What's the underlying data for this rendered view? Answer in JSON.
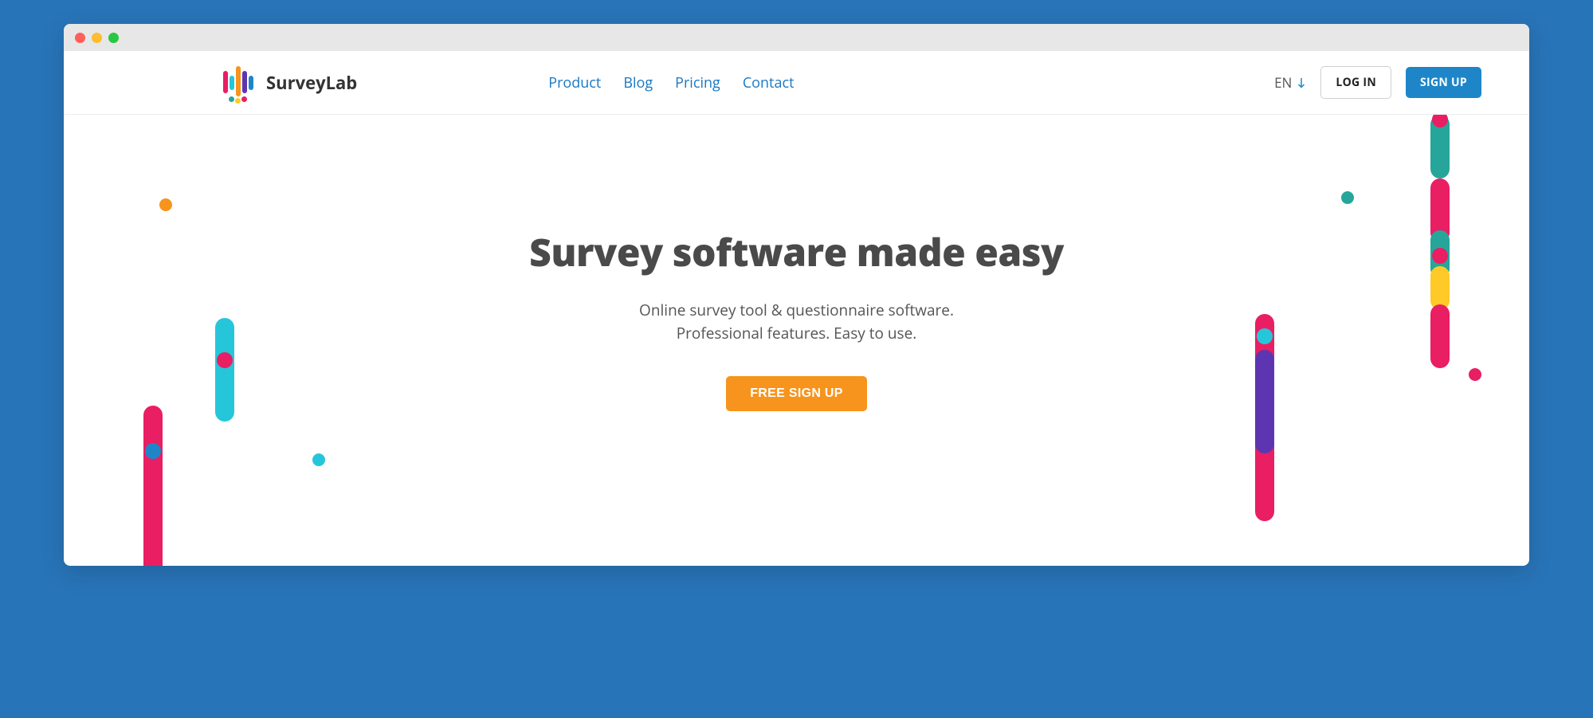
{
  "brand": {
    "name": "SurveyLab"
  },
  "nav": {
    "items": [
      {
        "label": "Product"
      },
      {
        "label": "Blog"
      },
      {
        "label": "Pricing"
      },
      {
        "label": "Contact"
      }
    ]
  },
  "header": {
    "language": "EN",
    "login_label": "LOG IN",
    "signup_label": "SIGN UP"
  },
  "hero": {
    "title": "Survey software made easy",
    "subtitle_line1": "Online survey tool & questionnaire software.",
    "subtitle_line2": "Professional features. Easy to use.",
    "cta_label": "FREE SIGN UP"
  },
  "colors": {
    "accent_blue": "#1e86c8",
    "accent_orange": "#f7941d",
    "pink": "#e91e63",
    "cyan": "#26c6da",
    "purple": "#5e35b1",
    "green": "#26a69a",
    "yellow": "#ffca28"
  }
}
